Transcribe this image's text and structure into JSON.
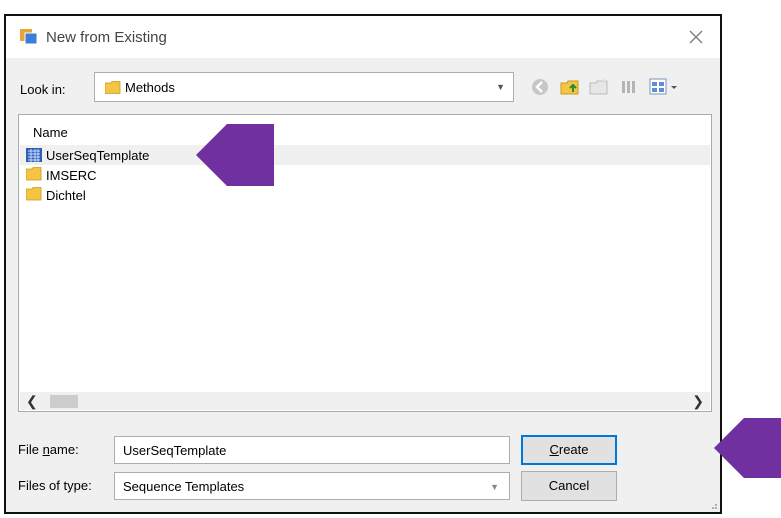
{
  "window": {
    "title": "New from Existing"
  },
  "look_in": {
    "label": "Look in:",
    "value": "Methods"
  },
  "list": {
    "header": "Name",
    "items": [
      {
        "name": "UserSeqTemplate",
        "icon": "sequence-template-icon",
        "selected": true
      },
      {
        "name": "IMSERC",
        "icon": "folder-icon",
        "selected": false
      },
      {
        "name": "Dichtel",
        "icon": "folder-icon",
        "selected": false
      }
    ]
  },
  "file_name": {
    "label_pre": "File ",
    "label_accel": "n",
    "label_post": "ame:",
    "value": "UserSeqTemplate"
  },
  "file_type": {
    "label": "Files of type:",
    "value": "Sequence Templates"
  },
  "buttons": {
    "create_accel": "C",
    "create_rest": "reate",
    "cancel": "Cancel"
  },
  "colors": {
    "annotation_arrow": "#7030a0",
    "default_button_border": "#0078d7",
    "folder": "#f4c542"
  }
}
